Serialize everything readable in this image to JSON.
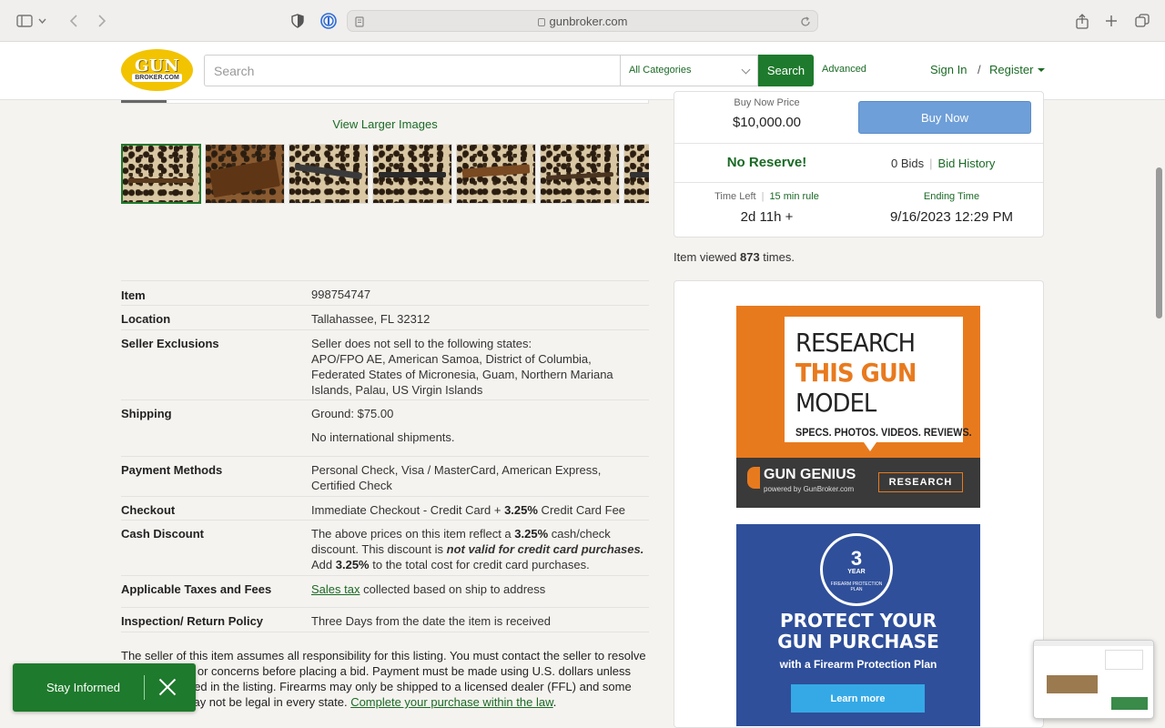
{
  "browser": {
    "url": "gunbroker.com"
  },
  "header": {
    "logo_text": "GUN",
    "logo_sub": "BROKER.COM",
    "search_placeholder": "Search",
    "category": "All Categories",
    "search_button": "Search",
    "advanced": "Advanced",
    "sign_in": "Sign In",
    "separator": "/",
    "register": "Register"
  },
  "gallery": {
    "view_larger": "View Larger Images",
    "thumbnail_count": 7
  },
  "details": {
    "item_label": "Item",
    "item_value": "998754747",
    "location_label": "Location",
    "location_value": "Tallahassee, FL 32312",
    "exclusions_label": "Seller Exclusions",
    "exclusions_line1": "Seller does not sell to the following states:",
    "exclusions_line2": "APO/FPO AE, American Samoa, District of Columbia, Federated States of Micronesia, Guam, Northern Mariana Islands, Palau, US Virgin Islands",
    "shipping_label": "Shipping",
    "shipping_line1": "Ground: $75.00",
    "shipping_line2": "No international shipments.",
    "payment_label": "Payment Methods",
    "payment_value": "Personal Check, Visa / MasterCard, American Express, Certified Check",
    "checkout_label": "Checkout",
    "checkout_pre": "Immediate Checkout - Credit Card + ",
    "checkout_pct": "3.25%",
    "checkout_post": " Credit Card Fee",
    "cash_label": "Cash Discount",
    "cash_pre": "The above prices on this item reflect a ",
    "cash_pct1": "3.25%",
    "cash_mid": " cash/check discount. This discount is ",
    "cash_italic": "not valid for credit card purchases.",
    "cash_add": " Add ",
    "cash_pct2": "3.25%",
    "cash_post": " to the total cost for credit card purchases.",
    "taxes_label": "Applicable Taxes and Fees",
    "taxes_link": "Sales tax",
    "taxes_post": " collected based on ship to address",
    "inspection_label": "Inspection/ Return Policy",
    "inspection_value": "Three Days from the date the item is received"
  },
  "disclaimer": {
    "text": "The seller of this item assumes all responsibility for this listing. You must contact the seller to resolve any questions or concerns before placing a bid. Payment must be made using U.S. dollars unless otherwise stated in the listing. Firearms may only be shipped to a licensed dealer (FFL) and some listed items may not be legal in every state. ",
    "link": "Complete your purchase within the law",
    "end": "."
  },
  "buy_box": {
    "price_label": "Buy Now Price",
    "price": "$10,000.00",
    "buy_now": "Buy Now",
    "no_reserve": "No Reserve!",
    "bids": "0 Bids",
    "bid_history": "Bid History",
    "time_left_label": "Time Left",
    "rule": "15 min rule",
    "time_left": "2d 11h +",
    "ending_label": "Ending Time",
    "ending_value": "9/16/2023 12:29 PM"
  },
  "views": {
    "pre": "Item viewed ",
    "count": "873",
    "post": " times."
  },
  "ad_research": {
    "line1": "RESEARCH",
    "line2": "THIS GUN",
    "line3": "MODEL",
    "tagline": "SPECS. PHOTOS. VIDEOS. REVIEWS.",
    "brand": "GUN GENIUS",
    "brand_sub": "powered by GunBroker.com",
    "button": "RESEARCH"
  },
  "ad_protect": {
    "badge_num": "3",
    "badge_year": "YEAR",
    "badge_text": "FIREARM PROTECTION PLAN",
    "headline1": "PROTECT YOUR",
    "headline2": "GUN PURCHASE",
    "sub": "with a Firearm Protection Plan",
    "button": "Learn more"
  },
  "stay_informed": {
    "label": "Stay Informed"
  },
  "colors": {
    "brand_green": "#1e7a2c",
    "buy_now_blue": "#6f9fd8",
    "logo_yellow": "#f2c300",
    "ad_orange": "#e87a1e",
    "ad_blue": "#2f4f9a"
  }
}
